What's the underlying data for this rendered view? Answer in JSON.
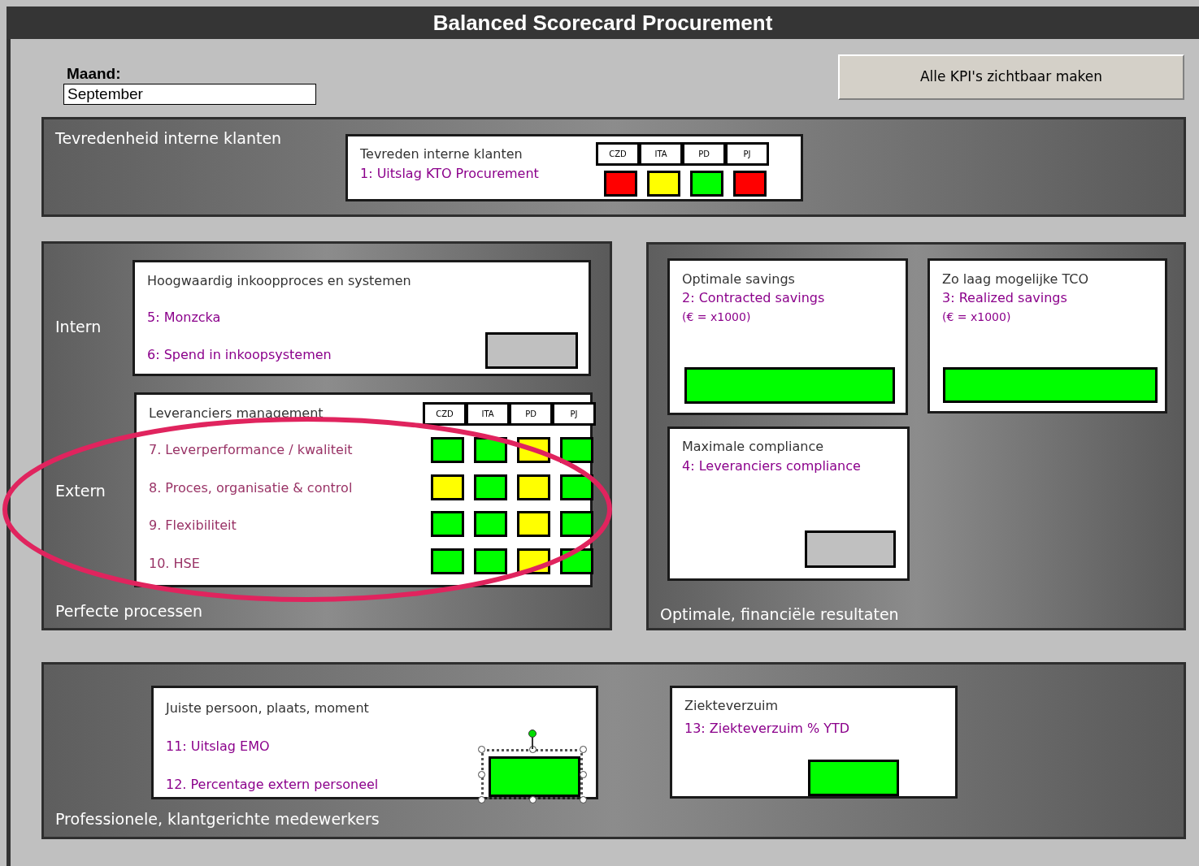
{
  "title": "Balanced Scorecard Procurement",
  "month": {
    "label": "Maand:",
    "value": "September"
  },
  "button": "Alle KPI's zichtbaar maken",
  "panels": [
    {
      "labels": [
        "Tevredenheid interne klanten"
      ]
    },
    {
      "labels": [
        "Intern",
        "Extern",
        "Perfecte processen"
      ]
    },
    {
      "labels": [
        "Optimale, financiële resultaten"
      ]
    },
    {
      "labels": [
        "Professionele, klantgerichte medewerkers"
      ]
    }
  ],
  "cards": [
    {
      "title": "Tevreden interne klanten",
      "kpis": [
        "1: Uitslag KTO Procurement"
      ],
      "columns": [
        "CZD",
        "ITA",
        "PD",
        "PJ"
      ],
      "grid": [
        [
          {
            "color": "#ff0000"
          },
          {
            "color": "#ffff00"
          },
          {
            "color": "#00ff00"
          },
          {
            "color": "#ff0000"
          }
        ]
      ]
    },
    {
      "title": "Hoogwaardig inkoopproces en systemen",
      "kpis": [
        "5: Monzcka",
        "6: Spend in inkoopsystemen"
      ],
      "indicator": {
        "color": "#c0c0c0",
        "selected": false
      }
    },
    {
      "title": "Leveranciers management",
      "kpis": [
        "7. Leverperformance / kwaliteit",
        "8. Proces, organisatie & control",
        "9. Flexibiliteit",
        "10. HSE"
      ],
      "columns": [
        "CZD",
        "ITA",
        "PD",
        "PJ"
      ],
      "grid": [
        [
          {
            "color": "#00ff00"
          },
          {
            "color": "#00ff00"
          },
          {
            "color": "#ffff00"
          },
          {
            "color": "#00ff00"
          }
        ],
        [
          {
            "color": "#ffff00"
          },
          {
            "color": "#00ff00"
          },
          {
            "color": "#ffff00"
          },
          {
            "color": "#00ff00"
          }
        ],
        [
          {
            "color": "#00ff00"
          },
          {
            "color": "#00ff00"
          },
          {
            "color": "#ffff00"
          },
          {
            "color": "#00ff00"
          }
        ],
        [
          {
            "color": "#00ff00"
          },
          {
            "color": "#00ff00"
          },
          {
            "color": "#ffff00"
          },
          {
            "color": "#00ff00"
          }
        ]
      ]
    },
    {
      "title": "Optimale savings",
      "kpis": [
        "2: Contracted savings"
      ],
      "note": "(€ = x1000)",
      "indicator": {
        "color": "#00ff00",
        "selected": false
      }
    },
    {
      "title": "Zo laag mogelijke TCO",
      "kpis": [
        "3: Realized savings"
      ],
      "note": "(€ = x1000)",
      "indicator": {
        "color": "#00ff00",
        "selected": false
      }
    },
    {
      "title": "Maximale compliance",
      "kpis": [
        "4: Leveranciers compliance"
      ],
      "indicator": {
        "color": "#c0c0c0",
        "selected": false
      }
    },
    {
      "title": "Juiste persoon, plaats, moment",
      "kpis": [
        "11: Uitslag EMO",
        "12. Percentage extern personeel"
      ],
      "indicator": {
        "color": "#00ff00",
        "selected": true
      }
    },
    {
      "title": "Ziekteverzuim",
      "kpis": [
        "13: Ziekteverzuim % YTD"
      ],
      "indicator": {
        "color": "#00ff00",
        "selected": false
      }
    }
  ]
}
